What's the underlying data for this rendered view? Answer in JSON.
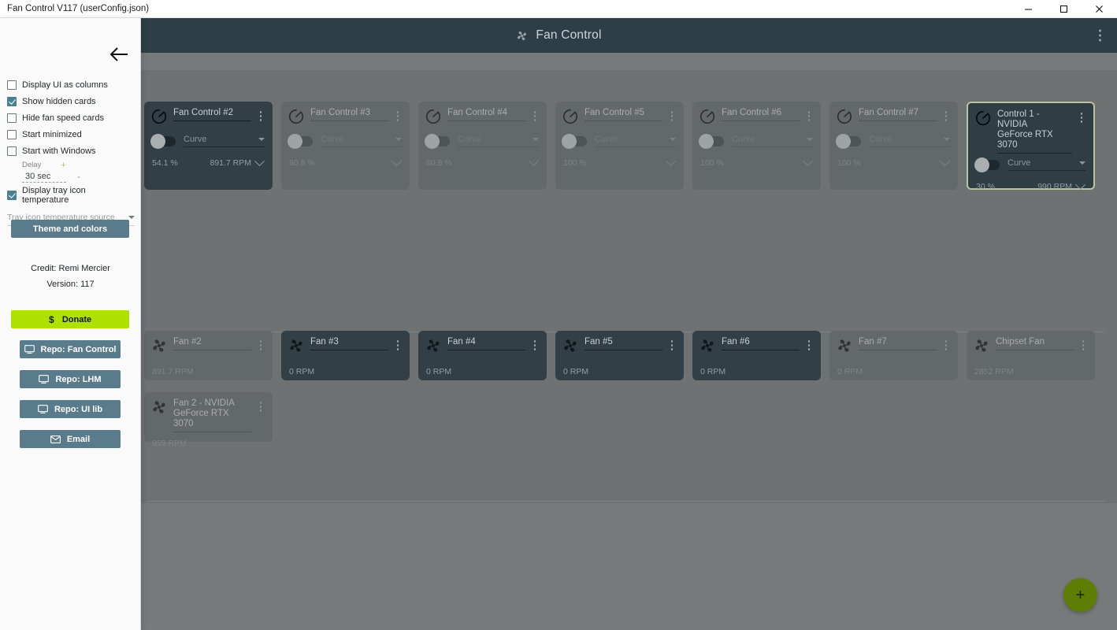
{
  "window": {
    "title": "Fan Control V117 (userConfig.json)",
    "controls": {
      "minimize": "minimize-button",
      "maximize": "maximize-button",
      "close": "close-button"
    }
  },
  "header": {
    "title": "Fan Control",
    "logo_icon": "fan-icon",
    "menu_icon": "kebab-menu-icon"
  },
  "settings": {
    "back_icon": "back-arrow-icon",
    "options": [
      {
        "label": "Display UI as columns",
        "checked": false
      },
      {
        "label": "Show hidden cards",
        "checked": true
      },
      {
        "label": "Hide fan speed cards",
        "checked": false
      },
      {
        "label": "Start minimized",
        "checked": false
      },
      {
        "label": "Start with Windows",
        "checked": false
      }
    ],
    "delay": {
      "label": "Delay",
      "plus": "+",
      "minus": "-",
      "value": "30 sec"
    },
    "tray_option": {
      "label": "Display tray icon temperature",
      "checked": true
    },
    "tray_source_placeholder": "Tray icon temperature source",
    "theme_button": "Theme and colors",
    "credit": "Credit: Remi Mercier",
    "version": "Version: 117",
    "buttons": [
      {
        "label": "Donate",
        "icon": "dollar-icon"
      },
      {
        "label": "Repo: Fan Control",
        "icon": "monitor-icon"
      },
      {
        "label": "Repo: LHM",
        "icon": "monitor-icon"
      },
      {
        "label": "Repo: UI lib",
        "icon": "monitor-icon"
      },
      {
        "label": "Email",
        "icon": "envelope-icon"
      }
    ],
    "accent_color": "#5a7b8c",
    "donate_color": "#aee000"
  },
  "control_cards": [
    {
      "name": "Fan Control #2",
      "mode": "Curve",
      "percent": "54.1 %",
      "rpm": "891.7 RPM",
      "style": "dark",
      "show_rpm": true
    },
    {
      "name": "Fan Control #3",
      "mode": "Curve",
      "percent": "80.8 %",
      "rpm": "",
      "style": "dim",
      "show_rpm": false
    },
    {
      "name": "Fan Control #4",
      "mode": "Curve",
      "percent": "80.8 %",
      "rpm": "",
      "style": "dim",
      "show_rpm": false
    },
    {
      "name": "Fan Control #5",
      "mode": "Curve",
      "percent": "100 %",
      "rpm": "",
      "style": "dim",
      "show_rpm": false
    },
    {
      "name": "Fan Control #6",
      "mode": "Curve",
      "percent": "100 %",
      "rpm": "",
      "style": "dim",
      "show_rpm": false
    },
    {
      "name": "Fan Control #7",
      "mode": "Curve",
      "percent": "100 %",
      "rpm": "",
      "style": "dim",
      "show_rpm": false
    },
    {
      "name": "Control 1 - NVIDIA\nGeForce RTX 3070",
      "mode": "Curve",
      "percent": "30 %",
      "rpm": "990 RPM",
      "style": "selected",
      "show_rpm": true
    }
  ],
  "fan_cards": [
    {
      "name": "Fan #2",
      "rpm": "891.7 RPM",
      "style": "dim"
    },
    {
      "name": "Fan #3",
      "rpm": "0 RPM",
      "style": "dark"
    },
    {
      "name": "Fan #4",
      "rpm": "0 RPM",
      "style": "dark"
    },
    {
      "name": "Fan #5",
      "rpm": "0 RPM",
      "style": "dark"
    },
    {
      "name": "Fan #6",
      "rpm": "0 RPM",
      "style": "dark"
    },
    {
      "name": "Fan #7",
      "rpm": "0 RPM",
      "style": "dim"
    },
    {
      "name": "Chipset Fan",
      "rpm": "2852 RPM",
      "style": "dim"
    },
    {
      "name": "Fan 2 - NVIDIA\nGeForce RTX 3070",
      "rpm": "959 RPM",
      "style": "dim"
    }
  ],
  "fab": {
    "label": "+",
    "icon": "plus-icon",
    "color": "#5f7d05"
  }
}
